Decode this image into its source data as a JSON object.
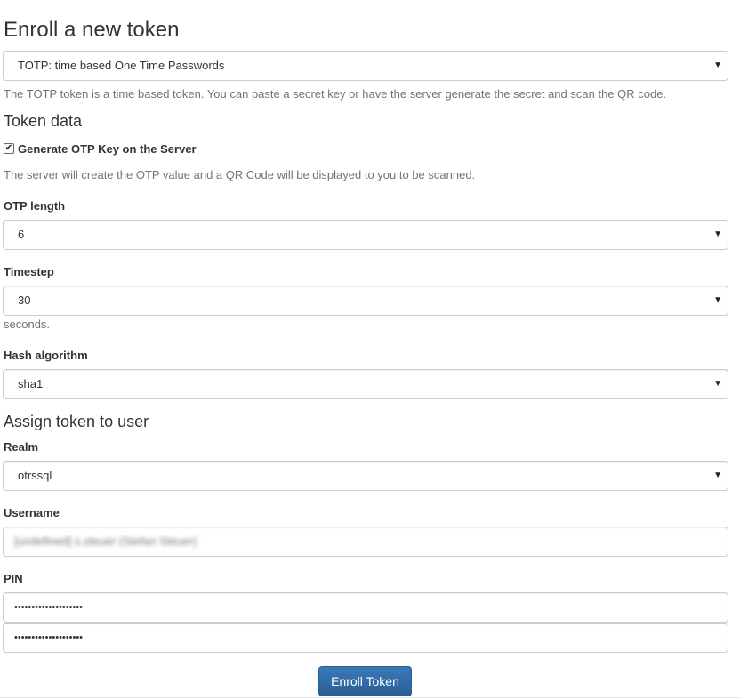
{
  "title": "Enroll a new token",
  "token_type": {
    "selected": "TOTP: time based One Time Passwords",
    "help": "The TOTP token is a time based token. You can paste a secret key or have the server generate the secret and scan the QR code."
  },
  "token_data": {
    "heading": "Token data",
    "generate_key": {
      "checked": true,
      "label": "Generate OTP Key on the Server",
      "help": "The server will create the OTP value and a QR Code will be displayed to you to be scanned."
    },
    "otp_length": {
      "label": "OTP length",
      "selected": "6"
    },
    "timestep": {
      "label": "Timestep",
      "selected": "30",
      "unit": "seconds."
    },
    "hash_algorithm": {
      "label": "Hash algorithm",
      "selected": "sha1"
    }
  },
  "assign": {
    "heading": "Assign token to user",
    "realm": {
      "label": "Realm",
      "selected": "otrssql"
    },
    "username": {
      "label": "Username",
      "value": "[undefined] s.steuer (Stefan Steuer)"
    },
    "pin": {
      "label": "PIN",
      "value_masked": "••••••••••••••••••••",
      "confirm_masked": "••••••••••••••••••••"
    }
  },
  "submit_label": "Enroll Token",
  "icons": {
    "select_arrow": "▼",
    "checkmark": "✔"
  }
}
